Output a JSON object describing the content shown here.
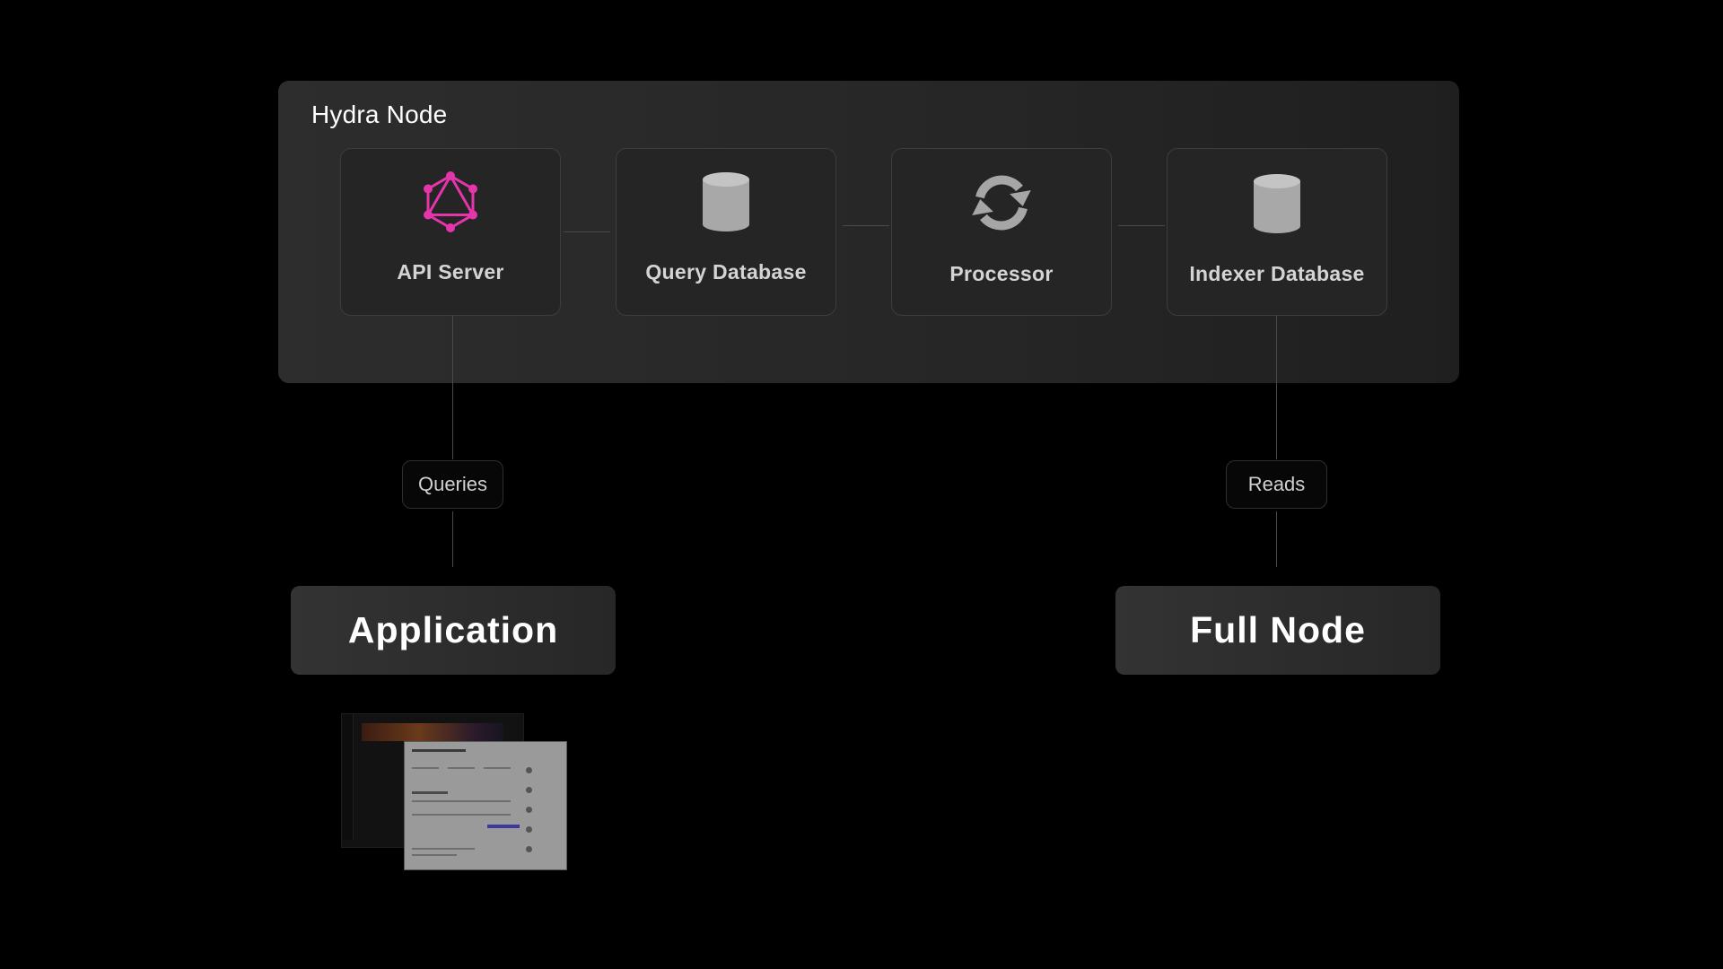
{
  "hydra_node": {
    "title": "Hydra Node",
    "components": [
      {
        "label": "API Server",
        "icon": "graphql-icon"
      },
      {
        "label": "Query Database",
        "icon": "database-icon"
      },
      {
        "label": "Processor",
        "icon": "refresh-cycle-icon"
      },
      {
        "label": "Indexer Database",
        "icon": "database-icon"
      }
    ]
  },
  "edges": [
    {
      "from": "API Server",
      "to": "Query Database"
    },
    {
      "from": "Processor",
      "to": "Query Database"
    },
    {
      "from": "Indexer Database",
      "to": "Processor"
    },
    {
      "from": "API Server",
      "to": "Application",
      "label": "Queries"
    },
    {
      "from": "Indexer Database",
      "to": "Full Node",
      "label": "Reads"
    }
  ],
  "targets": {
    "application": "Application",
    "full_node": "Full Node"
  },
  "colors": {
    "graphql_pink": "#e535ab",
    "icon_gray": "#a6a6a6"
  }
}
